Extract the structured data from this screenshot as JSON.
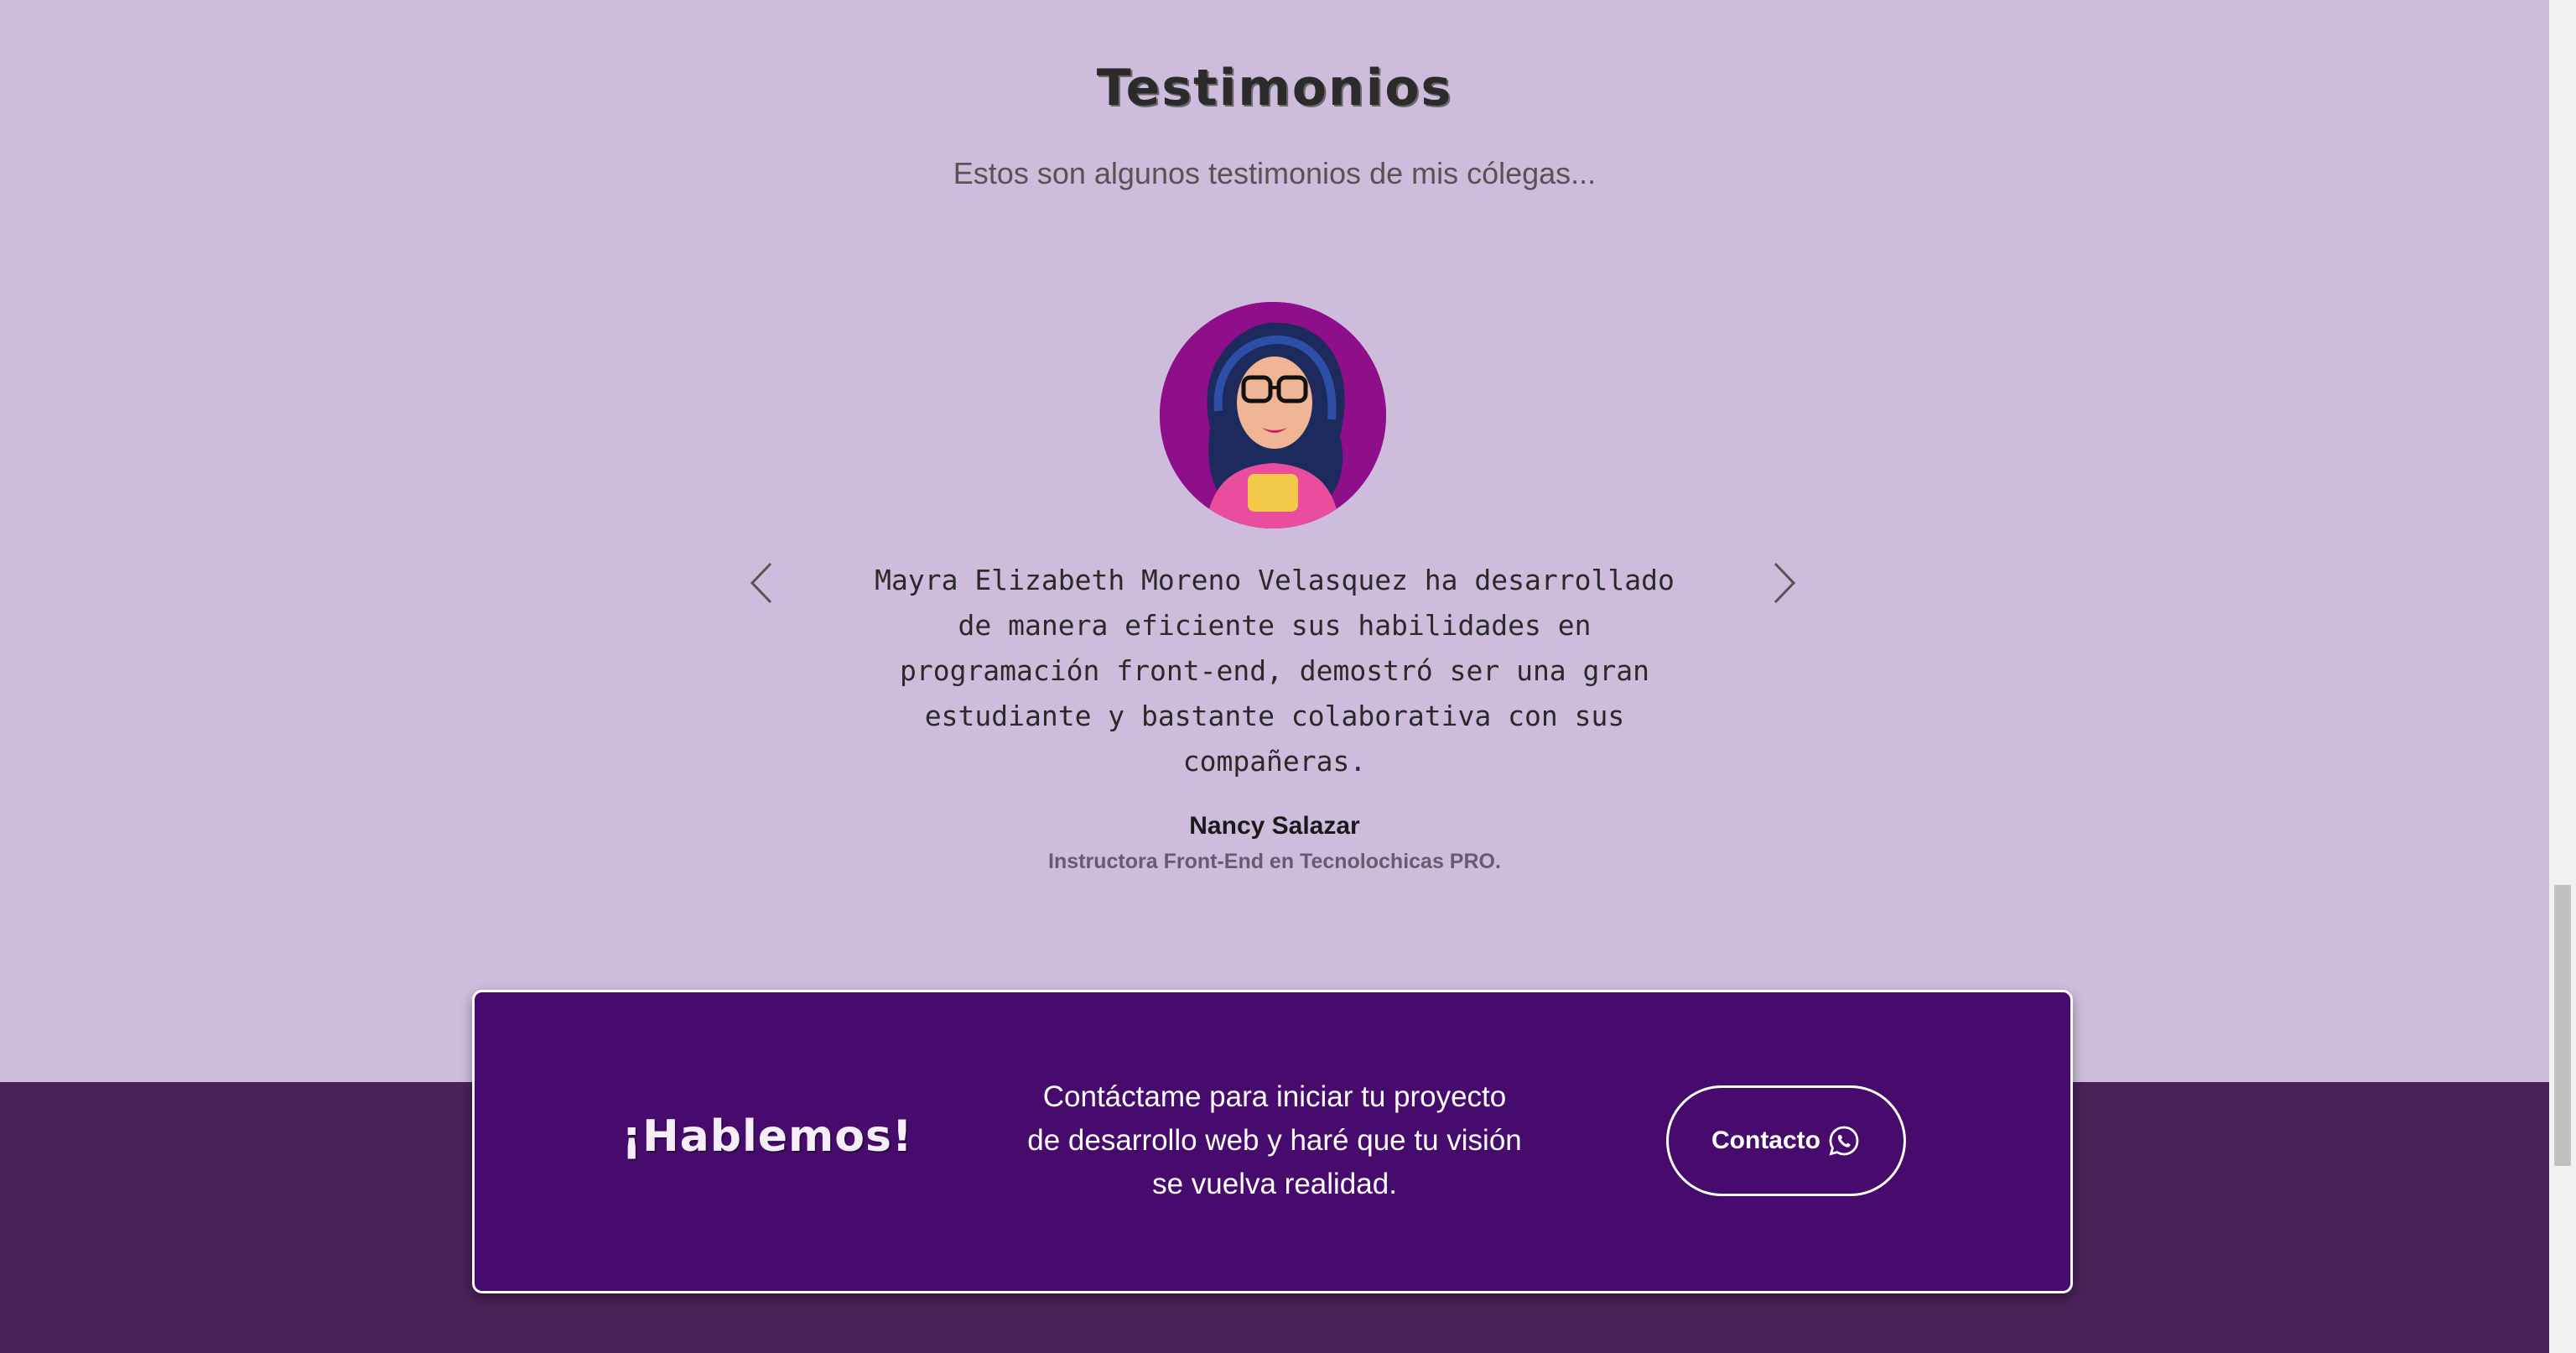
{
  "section": {
    "title": "Testimonios",
    "subtitle": "Estos son algunos testimonios de mis cólegas..."
  },
  "testimonial": {
    "quote": "Mayra Elizabeth Moreno Velasquez ha desarrollado de manera eficiente sus habilidades en programación front-end, demostró ser una gran estudiante y bastante colaborativa con sus compañeras.",
    "author": "Nancy Salazar",
    "role": "Instructora Front-End en Tecnolochicas PRO."
  },
  "cta": {
    "title": "¡Hablemos!",
    "text": "Contáctame para iniciar tu proyecto de desarrollo web y haré que tu visión se vuelva realidad.",
    "button_label": "Contacto",
    "button_icon": "whatsapp-icon"
  },
  "colors": {
    "background": "#cdbcdb",
    "footer_band": "#4a2159",
    "cta_panel": "#470b6e",
    "avatar_bg": "#8f0e8a"
  }
}
